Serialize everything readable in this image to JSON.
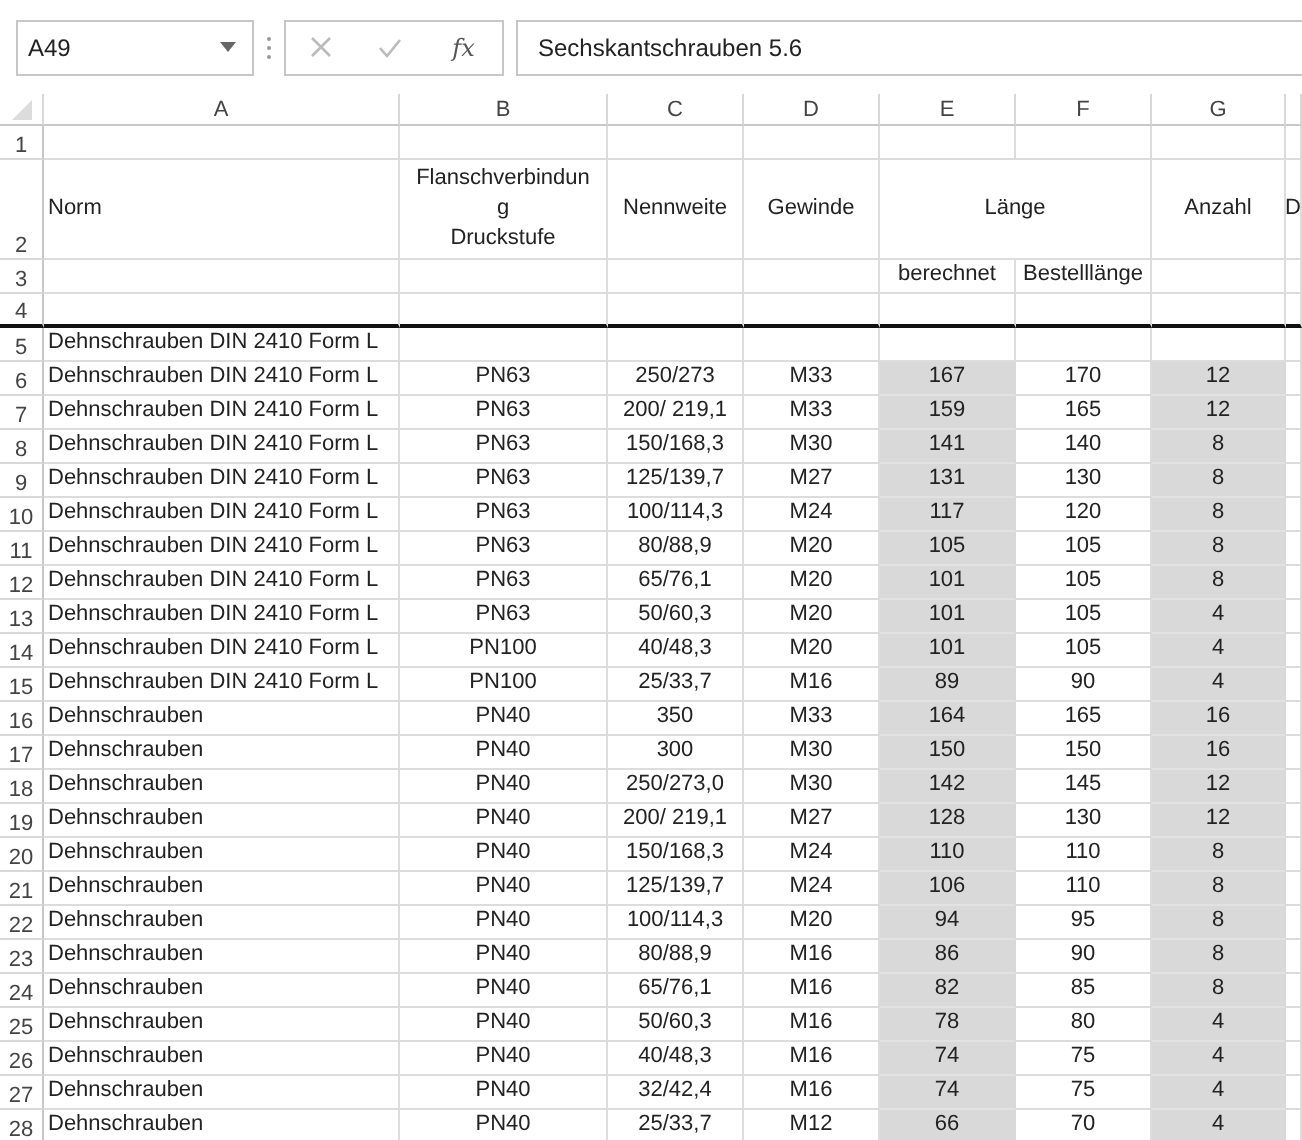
{
  "formula_bar": {
    "name_box": "A49",
    "function_button": "fx",
    "formula": "Sechskantschrauben 5.6"
  },
  "columns": [
    {
      "label": "A"
    },
    {
      "label": "B"
    },
    {
      "label": "C"
    },
    {
      "label": "D"
    },
    {
      "label": "E",
      "shaded": true
    },
    {
      "label": "F"
    },
    {
      "label": "G",
      "shaded": true
    }
  ],
  "rows": [
    {
      "number": "1",
      "kind": "blank",
      "cells": [
        null,
        null,
        null,
        null,
        null,
        null,
        null,
        null
      ]
    },
    {
      "number": "2",
      "kind": "heading",
      "cells": [
        "Norm",
        {
          "lines": [
            "Flanschverbindun",
            "g",
            "Druckstufe"
          ]
        },
        "Nennweite",
        "Gewinde",
        {
          "text": "Länge",
          "merged": true
        },
        "Anzahl",
        "D"
      ]
    },
    {
      "number": "3",
      "kind": "subheading",
      "cells": [
        null,
        null,
        null,
        null,
        "berechnet",
        "Bestelllänge",
        null,
        null
      ]
    },
    {
      "number": "4",
      "kind": "blank",
      "thick_bottom": true,
      "cells": [
        null,
        null,
        null,
        null,
        null,
        null,
        null,
        null
      ]
    },
    {
      "number": "5",
      "kind": "data",
      "cells": [
        "Dehnschrauben DIN 2410 Form L",
        null,
        null,
        null,
        null,
        null,
        null,
        null
      ]
    },
    {
      "number": "6",
      "kind": "data",
      "cells": [
        "Dehnschrauben DIN 2410 Form L",
        "PN63",
        "250/273",
        "M33",
        "167",
        "170",
        "12",
        null
      ]
    },
    {
      "number": "7",
      "kind": "data",
      "cells": [
        "Dehnschrauben DIN 2410 Form L",
        "PN63",
        "200/ 219,1",
        "M33",
        "159",
        "165",
        "12",
        null
      ]
    },
    {
      "number": "8",
      "kind": "data",
      "cells": [
        "Dehnschrauben DIN 2410 Form L",
        "PN63",
        "150/168,3",
        "M30",
        "141",
        "140",
        "8",
        null
      ]
    },
    {
      "number": "9",
      "kind": "data",
      "cells": [
        "Dehnschrauben DIN 2410 Form L",
        "PN63",
        "125/139,7",
        "M27",
        "131",
        "130",
        "8",
        null
      ]
    },
    {
      "number": "10",
      "kind": "data",
      "cells": [
        "Dehnschrauben DIN 2410 Form L",
        "PN63",
        "100/114,3",
        "M24",
        "117",
        "120",
        "8",
        null
      ]
    },
    {
      "number": "11",
      "kind": "data",
      "cells": [
        "Dehnschrauben DIN 2410 Form L",
        "PN63",
        "80/88,9",
        "M20",
        "105",
        "105",
        "8",
        null
      ]
    },
    {
      "number": "12",
      "kind": "data",
      "cells": [
        "Dehnschrauben DIN 2410 Form L",
        "PN63",
        "65/76,1",
        "M20",
        "101",
        "105",
        "8",
        null
      ]
    },
    {
      "number": "13",
      "kind": "data",
      "cells": [
        "Dehnschrauben DIN 2410 Form L",
        "PN63",
        "50/60,3",
        "M20",
        "101",
        "105",
        "4",
        null
      ]
    },
    {
      "number": "14",
      "kind": "data",
      "cells": [
        "Dehnschrauben DIN 2410 Form L",
        "PN100",
        "40/48,3",
        "M20",
        "101",
        "105",
        "4",
        null
      ]
    },
    {
      "number": "15",
      "kind": "data",
      "cells": [
        "Dehnschrauben DIN 2410 Form L",
        "PN100",
        "25/33,7",
        "M16",
        "89",
        "90",
        "4",
        null
      ]
    },
    {
      "number": "16",
      "kind": "data",
      "cells": [
        "Dehnschrauben",
        "PN40",
        "350",
        "M33",
        "164",
        "165",
        "16",
        null
      ]
    },
    {
      "number": "17",
      "kind": "data",
      "cells": [
        "Dehnschrauben",
        "PN40",
        "300",
        "M30",
        "150",
        "150",
        "16",
        null
      ]
    },
    {
      "number": "18",
      "kind": "data",
      "cells": [
        "Dehnschrauben",
        "PN40",
        "250/273,0",
        "M30",
        "142",
        "145",
        "12",
        null
      ]
    },
    {
      "number": "19",
      "kind": "data",
      "cells": [
        "Dehnschrauben",
        "PN40",
        "200/ 219,1",
        "M27",
        "128",
        "130",
        "12",
        null
      ]
    },
    {
      "number": "20",
      "kind": "data",
      "cells": [
        "Dehnschrauben",
        "PN40",
        "150/168,3",
        "M24",
        "110",
        "110",
        "8",
        null
      ]
    },
    {
      "number": "21",
      "kind": "data",
      "cells": [
        "Dehnschrauben",
        "PN40",
        "125/139,7",
        "M24",
        "106",
        "110",
        "8",
        null
      ]
    },
    {
      "number": "22",
      "kind": "data",
      "cells": [
        "Dehnschrauben",
        "PN40",
        "100/114,3",
        "M20",
        "94",
        "95",
        "8",
        null
      ]
    },
    {
      "number": "23",
      "kind": "data",
      "cells": [
        "Dehnschrauben",
        "PN40",
        "80/88,9",
        "M16",
        "86",
        "90",
        "8",
        null
      ]
    },
    {
      "number": "24",
      "kind": "data",
      "cells": [
        "Dehnschrauben",
        "PN40",
        "65/76,1",
        "M16",
        "82",
        "85",
        "8",
        null
      ]
    },
    {
      "number": "25",
      "kind": "data",
      "cells": [
        "Dehnschrauben",
        "PN40",
        "50/60,3",
        "M16",
        "78",
        "80",
        "4",
        null
      ]
    },
    {
      "number": "26",
      "kind": "data",
      "cells": [
        "Dehnschrauben",
        "PN40",
        "40/48,3",
        "M16",
        "74",
        "75",
        "4",
        null
      ]
    },
    {
      "number": "27",
      "kind": "data",
      "cells": [
        "Dehnschrauben",
        "PN40",
        "32/42,4",
        "M16",
        "74",
        "75",
        "4",
        null
      ]
    },
    {
      "number": "28",
      "kind": "data",
      "cells": [
        "Dehnschrauben",
        "PN40",
        "25/33,7",
        "M12",
        "66",
        "70",
        "4",
        null
      ]
    }
  ]
}
